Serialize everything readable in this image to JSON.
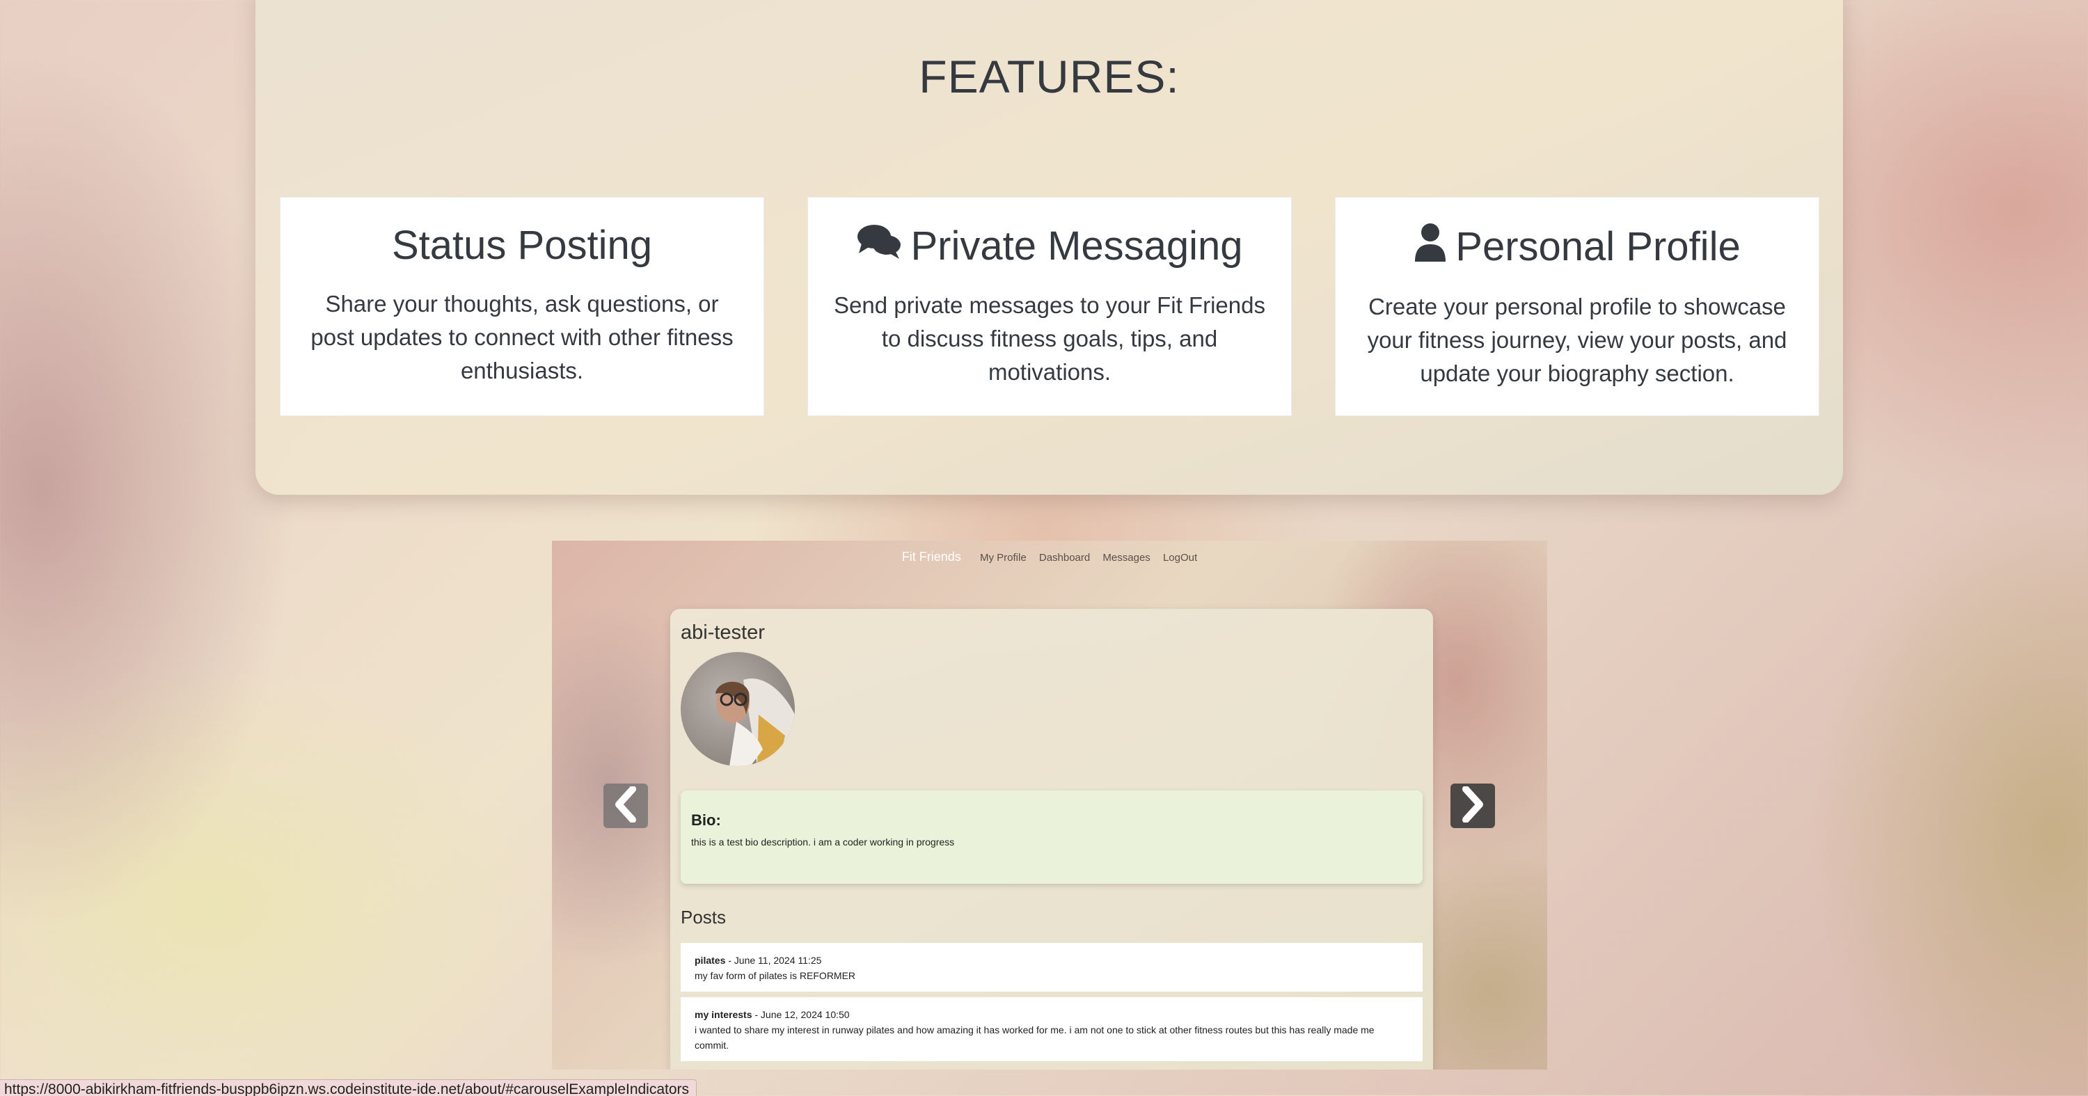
{
  "features": {
    "title": "FEATURES:",
    "cards": [
      {
        "title": "Status Posting",
        "icon": "none",
        "text": "Share your thoughts, ask questions, or post updates to connect with other fitness enthusiasts."
      },
      {
        "title": "Private Messaging",
        "icon": "comments-icon",
        "text": "Send private messages to your Fit Friends to discuss fitness goals, tips, and motivations."
      },
      {
        "title": "Personal Profile",
        "icon": "user-icon",
        "text": "Create your personal profile to showcase your fitness journey, view your posts, and update your biography section."
      }
    ]
  },
  "carousel": {
    "nav": {
      "brand": "Fit Friends",
      "links": [
        "My Profile",
        "Dashboard",
        "Messages",
        "LogOut"
      ]
    },
    "profile": {
      "username": "abi-tester",
      "bio_heading": "Bio:",
      "bio_text": "this is a test bio description. i am a coder working in progress",
      "posts_heading": "Posts",
      "posts": [
        {
          "title": "pilates",
          "date": " - June 11, 2024 11:25",
          "body": "my fav form of pilates is REFORMER"
        },
        {
          "title": "my interests",
          "date": " - June 12, 2024 10:50",
          "body": "i wanted to share my interest in runway pilates and how amazing it has worked for me. i am not one to stick at other fitness routes but this has really made me commit."
        }
      ]
    },
    "controls": {
      "prev_icon": "chevron-left-icon",
      "next_icon": "chevron-right-icon"
    }
  },
  "status_bar": {
    "url": "https://8000-abikirkham-fitfriends-busppb6ipzn.ws.codeinstitute-ide.net/about/#carouselExampleIndicators"
  }
}
